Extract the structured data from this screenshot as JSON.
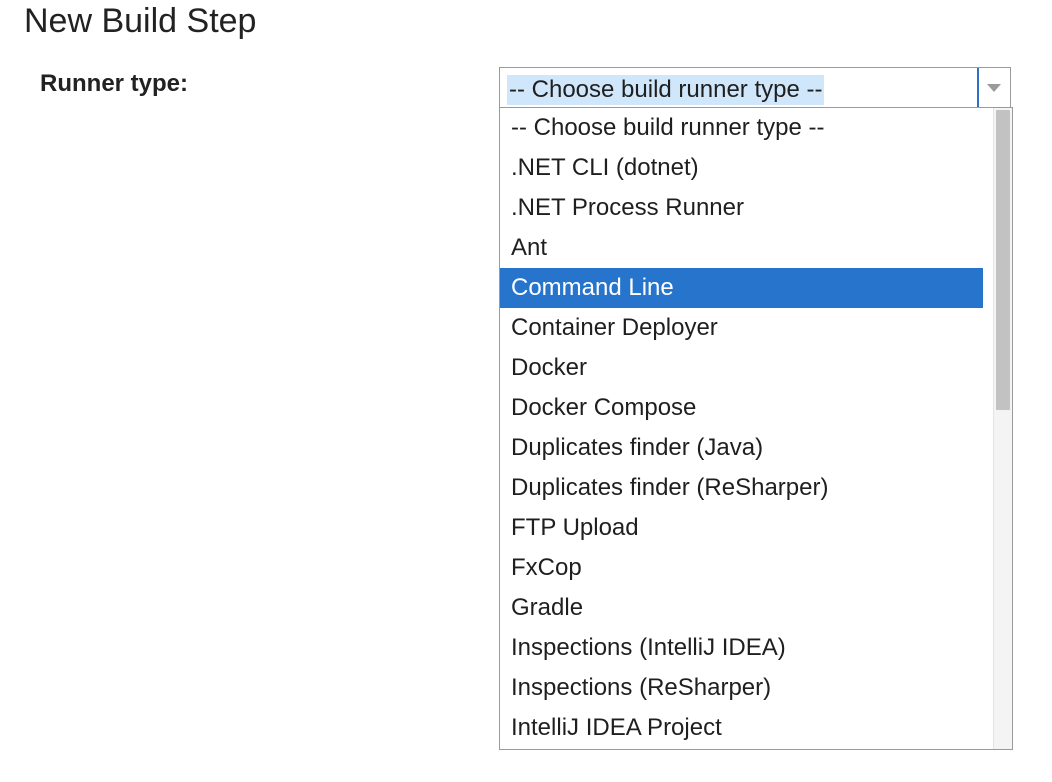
{
  "page": {
    "title": "New Build Step"
  },
  "form": {
    "runner_type_label": "Runner type:"
  },
  "select": {
    "current_value": "-- Choose build runner type --",
    "arrow_icon": "chevron-down-icon",
    "selected_index": 4,
    "options": [
      "-- Choose build runner type --",
      ".NET CLI (dotnet)",
      ".NET Process Runner",
      "Ant",
      "Command Line",
      "Container Deployer",
      "Docker",
      "Docker Compose",
      "Duplicates finder (Java)",
      "Duplicates finder (ReSharper)",
      "FTP Upload",
      "FxCop",
      "Gradle",
      "Inspections (IntelliJ IDEA)",
      "Inspections (ReSharper)",
      "IntelliJ IDEA Project"
    ]
  },
  "colors": {
    "highlight": "#2674cc",
    "value_highlight": "#cfe6fb",
    "focus_divider": "#2f6fc8"
  }
}
